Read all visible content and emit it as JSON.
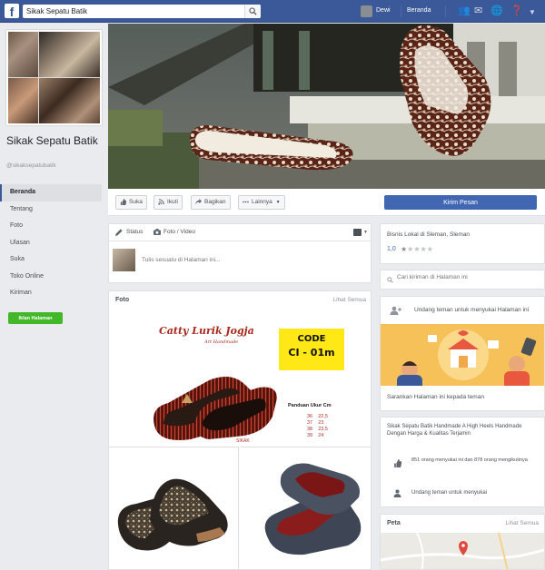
{
  "topbar": {
    "logo": "f",
    "search_value": "Sikak Sepatu Batik",
    "user_name": "Dewi",
    "home_label": "Beranda",
    "colors": {
      "bar": "#3b5998",
      "accent": "#4267b2"
    }
  },
  "left": {
    "page_name": "Sikak Sepatu Batik",
    "handle": "@sikaksepatubatik",
    "nav": [
      "Beranda",
      "Tentang",
      "Foto",
      "Ulasan",
      "Suka",
      "Toko Online",
      "Kiriman"
    ],
    "promote_label": "Iklan Halaman"
  },
  "action_bar": {
    "like_label": "Suka",
    "follow_label": "Ikuti",
    "share_label": "Bagikan",
    "more_label": "Lainnya",
    "send_label": "Kirim Pesan"
  },
  "composer": {
    "tab_status": "Status",
    "tab_photo": "Foto / Video",
    "placeholder": "Tulis sesuatu di Halaman ini..."
  },
  "photos": {
    "title": "Foto",
    "see_all": "Lihat Semua",
    "brand": "Catty Lurik Jogja",
    "brand_sub": "Art Handmade",
    "code_label": "CODE",
    "code_value": "CI - 01m",
    "size_title": "Panduan Ukur Cm",
    "sizes": [
      [
        "36",
        "22,5"
      ],
      [
        "37",
        "23"
      ],
      [
        "38",
        "23,5"
      ],
      [
        "39",
        "24"
      ]
    ]
  },
  "right": {
    "rating_text": "Bisnis Lokal di Sleman, Sleman",
    "rating_value": "1,0",
    "stars_filled": 1,
    "search_placeholder": "Cari kiriman di Halaman ini",
    "invite_text": "Undang teman untuk menyukai Halaman ini",
    "invite_link": "Sarankan Halaman ini kepada teman",
    "about_text": "Sikak Sepatu Batik Handmade A High Heels Handmade Dengan Harga & Kualitas Terjamin",
    "likes_text": "851 orang menyukai ini dan 878 orang mengikutinya",
    "invite_friends": "Undang teman untuk menyukai",
    "map_title": "Peta",
    "map_see_all": "Lihat Semua"
  }
}
